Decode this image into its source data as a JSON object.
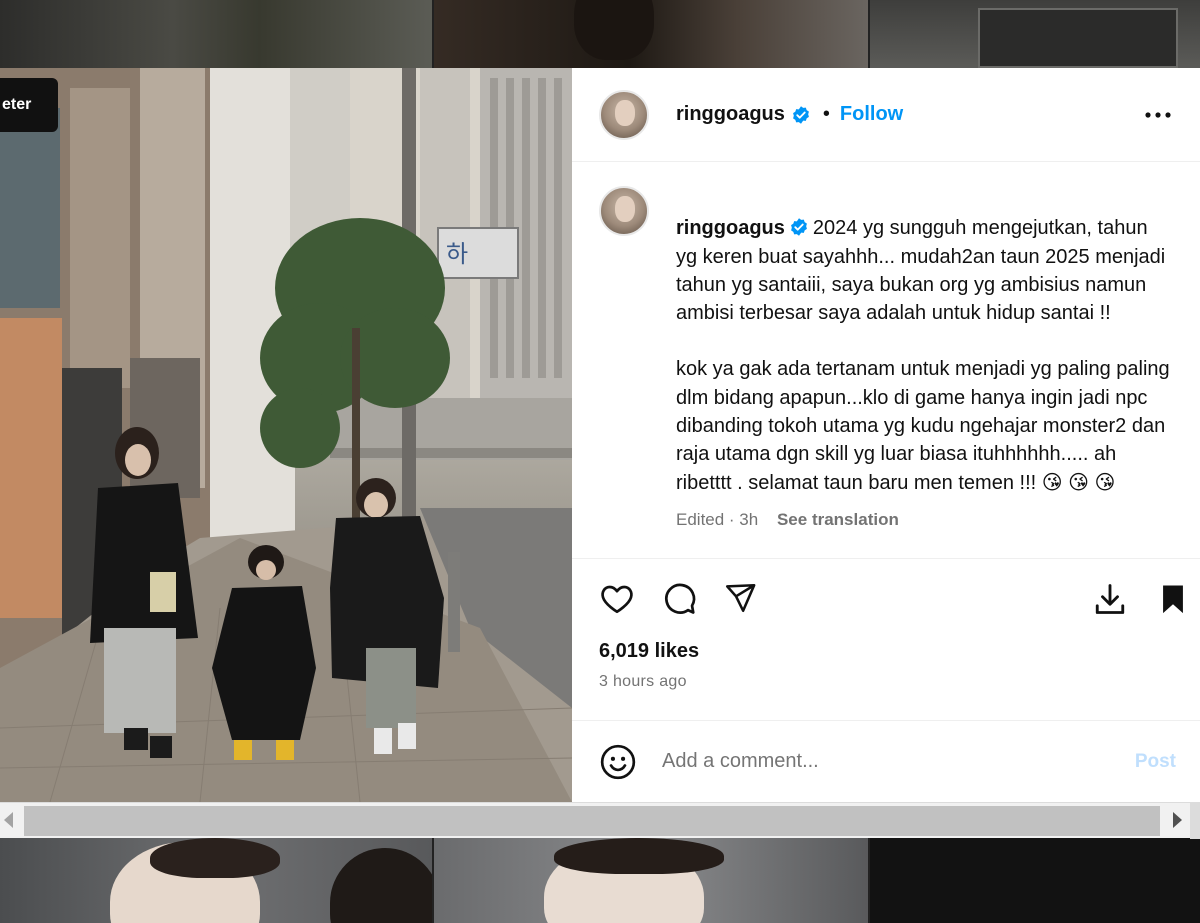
{
  "photo": {
    "tag_text": "eter",
    "user_tag_icon": "user-icon",
    "sign_text": "하"
  },
  "post": {
    "username": "ringgoagus",
    "verified_icon": "verified-badge-icon",
    "dot": "•",
    "follow_label": "Follow",
    "more_icon": "more-horizontal-icon",
    "caption_paragraph_1": "2024 yg sungguh mengejutkan, tahun yg keren buat sayahhh... mudah2an taun 2025 menjadi tahun yg santaiii, saya bukan org yg ambisius namun ambisi terbesar saya adalah untuk hidup santai !!",
    "caption_paragraph_2": "kok ya gak ada tertanam untuk menjadi yg paling paling dlm bidang apapun...klo di game hanya ingin jadi npc dibanding tokoh utama yg kudu ngehajar monster2 dan raja utama dgn skill yg luar biasa ituhhhhhh..... ah ribetttt . selamat taun baru men temen !!! 😘 😘 😘",
    "edited_label": "Edited · 3h",
    "see_translation": "See translation",
    "likes_label": "6,019 likes",
    "time_label": "3 hours ago",
    "comment_placeholder": "Add a comment...",
    "post_button": "Post",
    "icons": {
      "like": "heart-icon",
      "comment": "comment-icon",
      "share": "send-icon",
      "download": "download-icon",
      "save": "bookmark-icon",
      "emoji": "emoji-icon"
    },
    "colors": {
      "accent": "#0095f6",
      "verified": "#0095f6",
      "muted": "#737373",
      "post_disabled": "#c0dffd"
    }
  },
  "scrollbar": {
    "left_arrow_icon": "scroll-left-arrow-icon",
    "right_arrow_icon": "scroll-right-arrow-icon"
  }
}
